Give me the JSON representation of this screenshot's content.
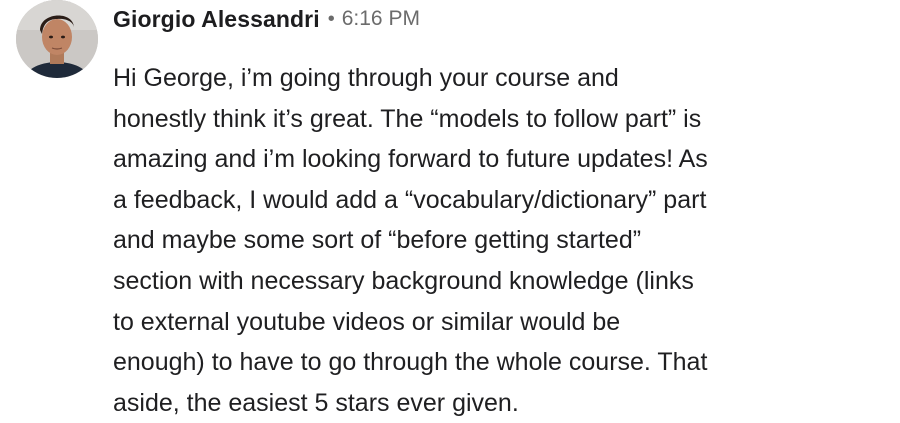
{
  "message": {
    "author": "Giorgio Alessandri",
    "separator": "•",
    "timestamp": "6:16 PM",
    "body_lines": [
      "Hi George, i’m going through your course and",
      "honestly think it’s great. The “models to follow part” is",
      "amazing and i’m looking forward to future updates! As",
      "a feedback, I would add a “vocabulary/dictionary” part",
      "and maybe some sort of “before getting started”",
      "section with necessary background knowledge (links",
      "to external youtube videos or similar would be",
      "enough) to have to go through the whole course. That",
      "aside, the easiest 5 stars ever given."
    ]
  },
  "avatar": {
    "icon": "user-avatar-photo",
    "background_color": "#c9c6c4"
  }
}
